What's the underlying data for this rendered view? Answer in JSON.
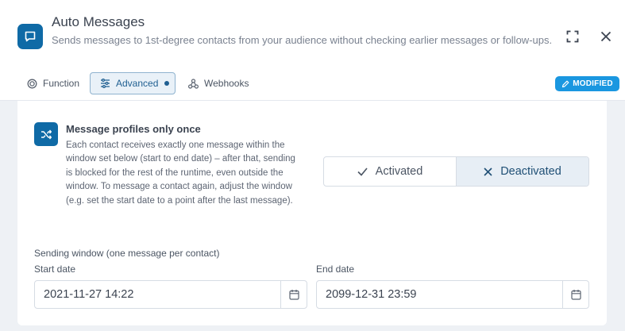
{
  "header": {
    "title": "Auto Messages",
    "subtitle": "Sends messages to 1st-degree contacts from your audience without checking earlier messages or follow-ups.",
    "icon": "chat-bubble-icon"
  },
  "tabs": [
    {
      "label": "Function",
      "icon": "target-icon",
      "active": false
    },
    {
      "label": "Advanced",
      "icon": "sliders-icon",
      "active": true
    },
    {
      "label": "Webhooks",
      "icon": "webhook-icon",
      "active": false
    }
  ],
  "badge": {
    "label": "MODIFIED",
    "icon": "pencil-icon"
  },
  "section": {
    "icon": "shuffle-icon",
    "title": "Message profiles only once",
    "description": "Each contact receives exactly one message within the window set below (start to end date) – after that, sending is blocked for the rest of the runtime, even outside the window. To message a contact again, adjust the window (e.g. set the start date to a point after the last message)."
  },
  "toggle": {
    "activated_label": "Activated",
    "deactivated_label": "Deactivated",
    "selected": "Deactivated"
  },
  "window": {
    "label": "Sending window (one message per contact)",
    "start_label": "Start date",
    "start_value": "2021-11-27 14:22",
    "end_label": "End date",
    "end_value": "2099-12-31 23:59"
  },
  "colors": {
    "primary": "#0f6aa6",
    "badge": "#1a97e0",
    "active_tab_bg": "#e9f1f8",
    "selected_toggle_bg": "#e7eef5"
  }
}
